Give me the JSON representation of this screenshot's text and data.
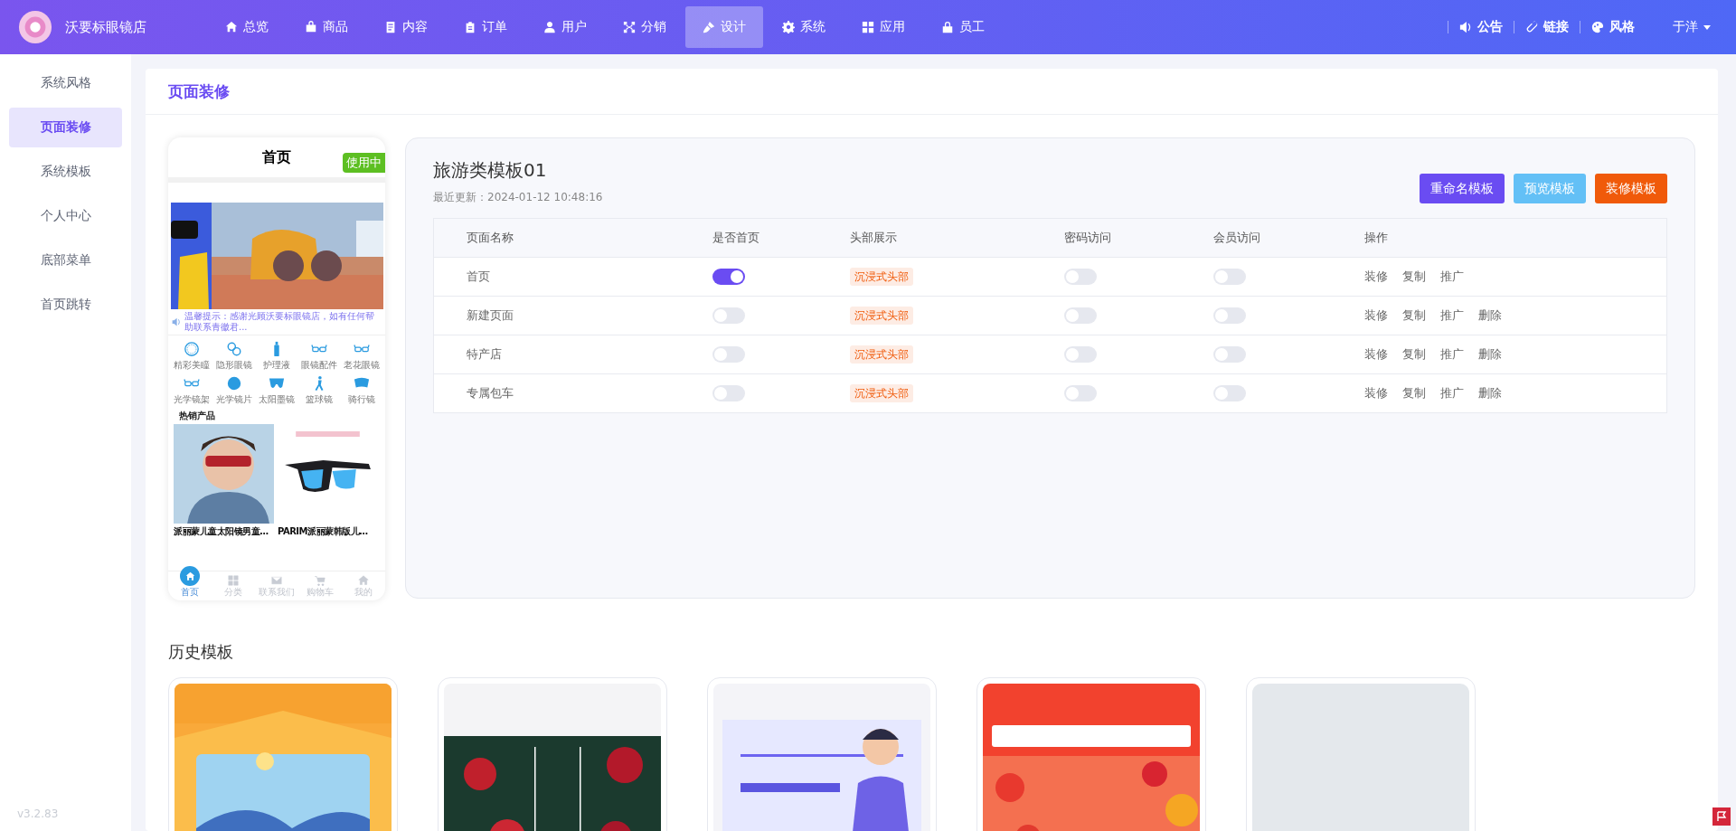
{
  "header": {
    "store_name": "沃要标眼镜店",
    "nav": [
      {
        "label": "总览",
        "selected": false
      },
      {
        "label": "商品",
        "selected": false
      },
      {
        "label": "内容",
        "selected": false
      },
      {
        "label": "订单",
        "selected": false
      },
      {
        "label": "用户",
        "selected": false
      },
      {
        "label": "分销",
        "selected": false
      },
      {
        "label": "设计",
        "selected": true
      },
      {
        "label": "系统",
        "selected": false
      },
      {
        "label": "应用",
        "selected": false
      },
      {
        "label": "员工",
        "selected": false
      }
    ],
    "links": [
      "公告",
      "链接",
      "风格"
    ],
    "user": "于洋"
  },
  "sidebar": {
    "items": [
      {
        "label": "系统风格",
        "selected": false
      },
      {
        "label": "页面装修",
        "selected": true
      },
      {
        "label": "系统模板",
        "selected": false
      },
      {
        "label": "个人中心",
        "selected": false
      },
      {
        "label": "底部菜单",
        "selected": false
      },
      {
        "label": "首页跳转",
        "selected": false
      }
    ],
    "version": "v3.2.83"
  },
  "page_title": "页面装修",
  "preview": {
    "title": "首页",
    "badge": "使用中",
    "notice": "温馨提示：感谢光顾沃要标眼镜店，如有任何帮助联系青徽君...",
    "categories": [
      "精彩美瞳",
      "隐形眼镜",
      "护理液",
      "眼镜配件",
      "老花眼镜",
      "光学镜架",
      "光学镜片",
      "太阳墨镜",
      "篮球镜",
      "骑行镜"
    ],
    "section_title": "热销产品",
    "products": [
      "派丽蒙儿童太阳镜男童...",
      "PARIM派丽蒙韩版儿..."
    ],
    "tabbar": [
      {
        "label": "首页",
        "selected": true
      },
      {
        "label": "分类",
        "selected": false
      },
      {
        "label": "联系我们",
        "selected": false
      },
      {
        "label": "购物车",
        "selected": false
      },
      {
        "label": "我的",
        "selected": false
      }
    ]
  },
  "template": {
    "name": "旅游类模板01",
    "updated": "最近更新：2024-01-12 10:48:16",
    "buttons": [
      {
        "label": "重命名模板",
        "kind": "rename"
      },
      {
        "label": "预览模板",
        "kind": "preview"
      },
      {
        "label": "装修模板",
        "kind": "decorate"
      }
    ],
    "columns": [
      "页面名称",
      "是否首页",
      "头部展示",
      "密码访问",
      "会员访问",
      "操作"
    ],
    "rows": [
      {
        "name": "首页",
        "is_home": true,
        "header": "沉浸式头部",
        "password": false,
        "member": false,
        "actions": [
          "装修",
          "复制",
          "推广"
        ]
      },
      {
        "name": "新建页面",
        "is_home": false,
        "header": "沉浸式头部",
        "password": false,
        "member": false,
        "actions": [
          "装修",
          "复制",
          "推广",
          "删除"
        ]
      },
      {
        "name": "特产店",
        "is_home": false,
        "header": "沉浸式头部",
        "password": false,
        "member": false,
        "actions": [
          "装修",
          "复制",
          "推广",
          "删除"
        ]
      },
      {
        "name": "专属包车",
        "is_home": false,
        "header": "沉浸式头部",
        "password": false,
        "member": false,
        "actions": [
          "装修",
          "复制",
          "推广",
          "删除"
        ]
      }
    ]
  },
  "history": {
    "title": "历史模板",
    "templates": [
      {
        "kind": "picture"
      },
      {
        "kind": "picture"
      },
      {
        "kind": "picture"
      },
      {
        "kind": "picture"
      },
      {
        "kind": "placeholder"
      }
    ]
  }
}
